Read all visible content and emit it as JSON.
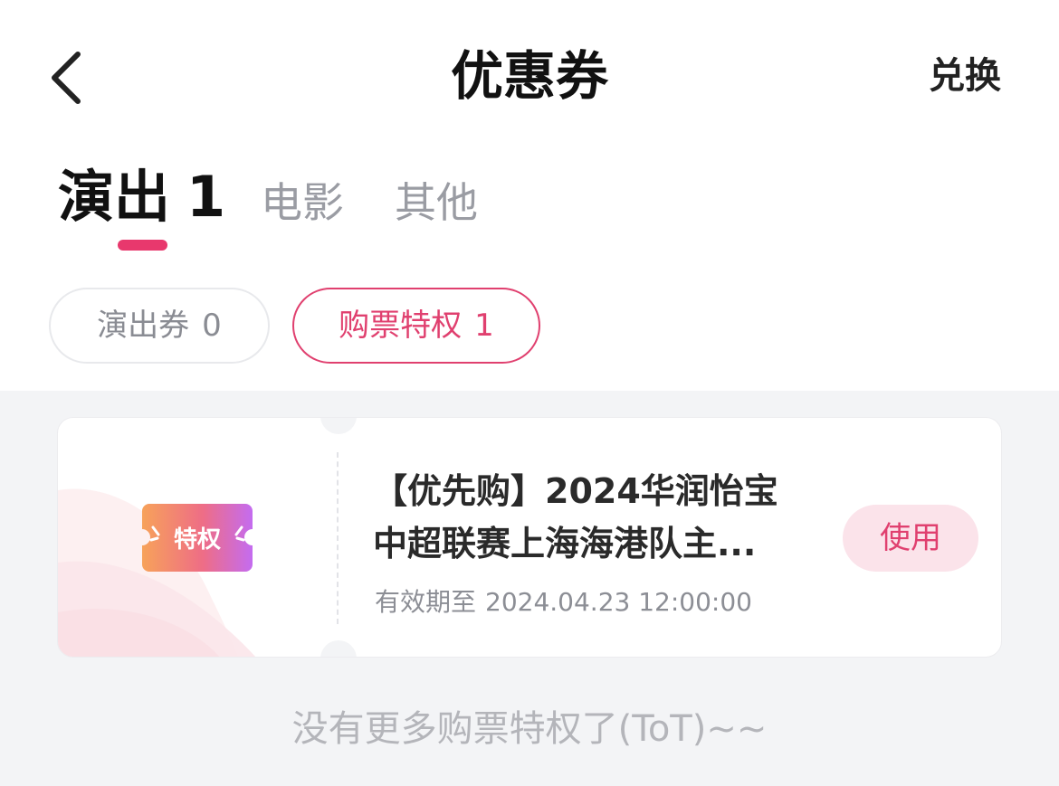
{
  "header": {
    "title": "优惠券",
    "back_icon": "chevron-left-icon",
    "redeem_label": "兑换"
  },
  "tabs": [
    {
      "label": "演出",
      "count": "1",
      "active": true
    },
    {
      "label": "电影",
      "count": "",
      "active": false
    },
    {
      "label": "其他",
      "count": "",
      "active": false
    }
  ],
  "filters": [
    {
      "label": "演出券",
      "count": "0",
      "selected": false
    },
    {
      "label": "购票特权",
      "count": "1",
      "selected": true
    }
  ],
  "coupon": {
    "badge_text": "特权",
    "title_line1": "【优先购】2024华润怡宝",
    "title_line2": "中超联赛上海海港队主...",
    "expiry_label": "有效期至",
    "expiry_value": "2024.04.23 12:00:00",
    "use_label": "使用"
  },
  "footer": {
    "empty_tip": "没有更多购票特权了(ToT)~~"
  },
  "colors": {
    "accent": "#e0406f",
    "tab_indicator": "#e8386d",
    "use_button_bg": "#fbe3ea",
    "page_bg": "#f3f4f6"
  }
}
